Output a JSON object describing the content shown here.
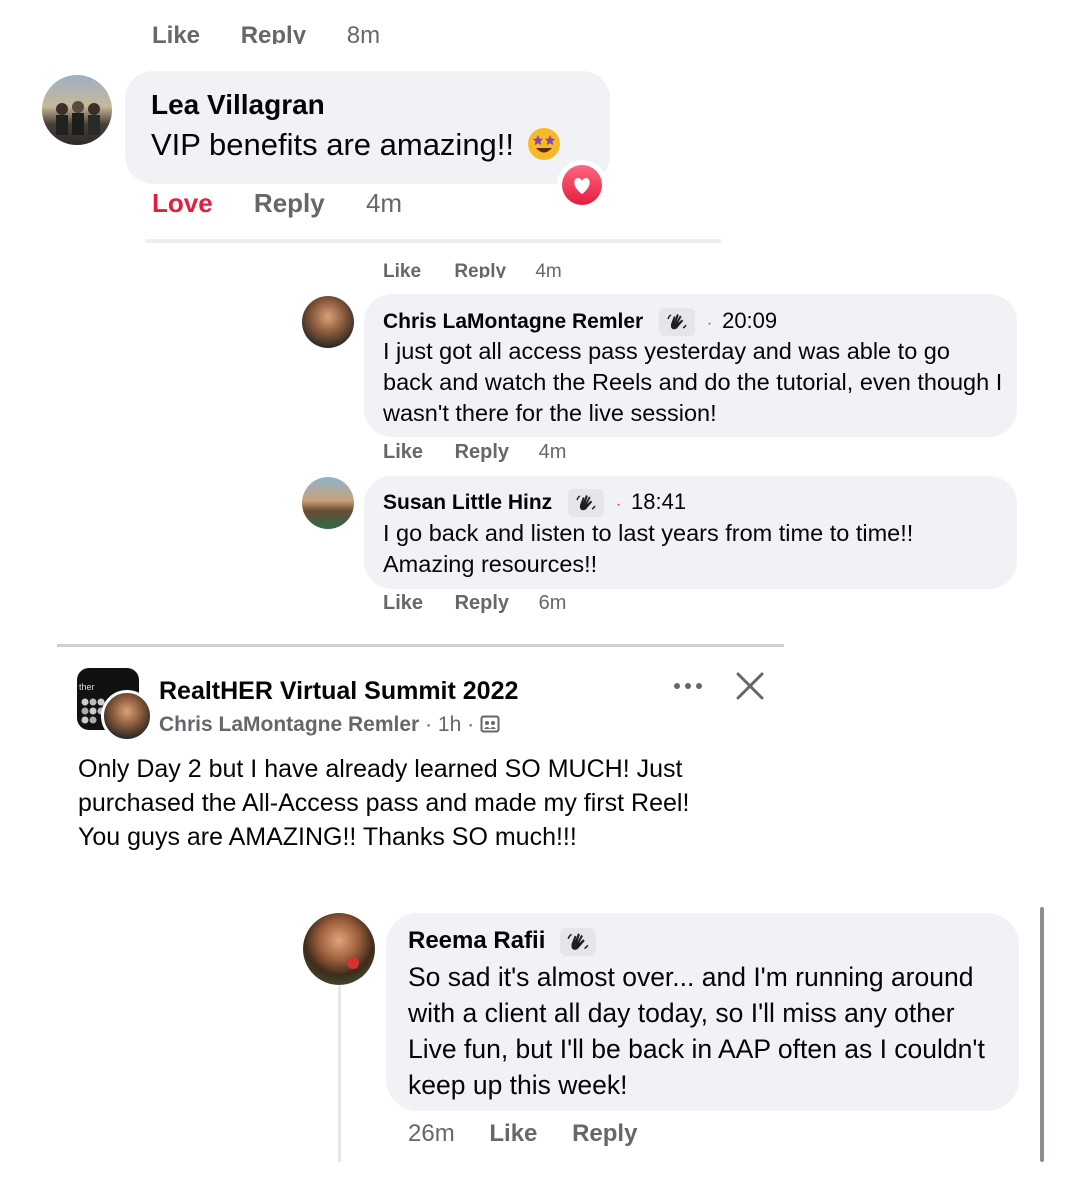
{
  "top_cut": {
    "like": "Like",
    "reply": "Reply",
    "time": "8m"
  },
  "lea": {
    "name": "Lea Villagran",
    "text": "VIP benefits are amazing!!",
    "reaction_label": "Love",
    "reply": "Reply",
    "time": "4m"
  },
  "mid_cut": {
    "like": "Like",
    "reply": "Reply",
    "time": "4m"
  },
  "chris_comment": {
    "name": "Chris LaMontagne Remler",
    "dot": "·",
    "clock": "20:09",
    "text": "I just got all access pass yesterday and was able to go back and watch the Reels and do the tutorial, even though I wasn't there for the live session!",
    "like": "Like",
    "reply": "Reply",
    "time": "4m"
  },
  "susan_comment": {
    "name": "Susan Little Hinz",
    "dot": "·",
    "clock": "18:41",
    "text": "I go back and listen to last years from time to time!! Amazing resources!!",
    "like": "Like",
    "reply": "Reply",
    "time": "6m"
  },
  "post": {
    "group": "RealtHER Virtual Summit 2022",
    "author": "Chris LaMontagne Remler",
    "age": "1h",
    "sep": "·",
    "body": "Only Day 2 but I have already learned SO MUCH! Just purchased the All-Access pass and made my first Reel! You guys are AMAZING!! Thanks SO much!!!",
    "group_avatar_text": "ther"
  },
  "reema_comment": {
    "name": "Reema Rafii",
    "text": "So sad it's almost over... and I'm running around with a client all day today, so I'll miss any other Live fun, but I'll be back in AAP often as I couldn't keep up this week!",
    "time": "26m",
    "like": "Like",
    "reply": "Reply"
  },
  "icons": [
    "wave-hand-icon",
    "heart-icon",
    "star-struck-emoji-icon",
    "more-options-icon",
    "close-icon",
    "group-audience-icon"
  ],
  "colors": {
    "love": "#e41e3f",
    "bubble": "#f0f2f5",
    "meta": "#65676b"
  }
}
